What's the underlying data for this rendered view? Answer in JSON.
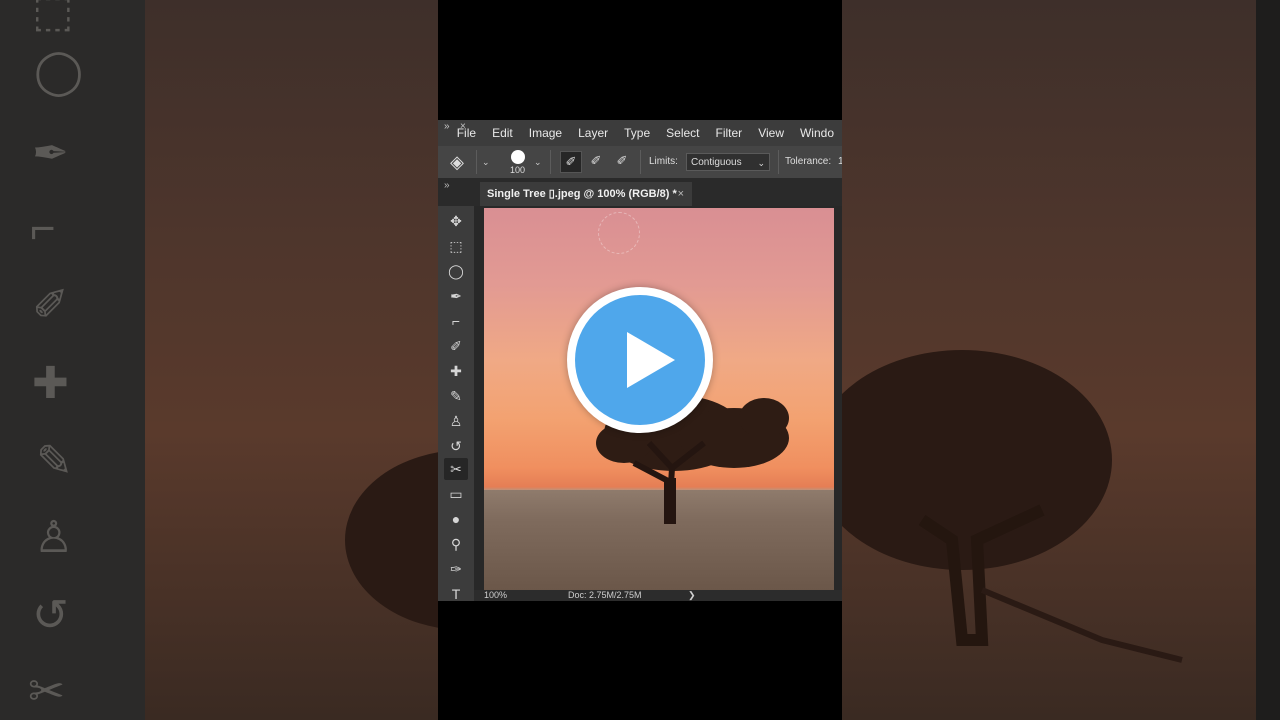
{
  "colors": {
    "ps_bg": "#323232",
    "menubar_bg": "#3c3c3c",
    "play_blue": "#4fa7eb",
    "sky_top": "#d98f93",
    "sky_bottom": "#f08f5f",
    "ground": "#7a6657"
  },
  "menu": {
    "panel_collapse": "»",
    "panel_close": "×",
    "items": [
      "File",
      "Edit",
      "Image",
      "Layer",
      "Type",
      "Select",
      "Filter",
      "View",
      "Windo"
    ]
  },
  "options": {
    "layers_icon": "layers-icon",
    "brush_size": "100",
    "limits_label": "Limits:",
    "limits_value": "Contiguous",
    "tolerance_label": "Tolerance:",
    "tolerance_value": "1"
  },
  "document": {
    "tab_title": "Single Tree ▯.jpeg @ 100% (RGB/8) *",
    "tab_close": "×"
  },
  "tools": [
    {
      "name": "move-tool",
      "glyph": "✥"
    },
    {
      "name": "marquee-tool",
      "glyph": "⬚"
    },
    {
      "name": "lasso-tool",
      "glyph": "◯"
    },
    {
      "name": "quick-selection-tool",
      "glyph": "✒"
    },
    {
      "name": "crop-tool",
      "glyph": "⌐"
    },
    {
      "name": "eyedropper-tool",
      "glyph": "✐"
    },
    {
      "name": "healing-brush-tool",
      "glyph": "✚"
    },
    {
      "name": "brush-tool",
      "glyph": "✎"
    },
    {
      "name": "clone-stamp-tool",
      "glyph": "♙"
    },
    {
      "name": "history-brush-tool",
      "glyph": "↺"
    },
    {
      "name": "background-eraser-tool",
      "glyph": "✂"
    },
    {
      "name": "gradient-tool",
      "glyph": "▭"
    },
    {
      "name": "blur-tool",
      "glyph": "●"
    },
    {
      "name": "dodge-tool",
      "glyph": "⚲"
    },
    {
      "name": "pen-tool",
      "glyph": "✑"
    },
    {
      "name": "type-tool",
      "glyph": "T"
    }
  ],
  "status": {
    "zoom": "100%",
    "doc_size": "Doc: 2.75M/2.75M",
    "arrow": "❯"
  },
  "overlay": {
    "play_icon": "play-button-icon"
  }
}
